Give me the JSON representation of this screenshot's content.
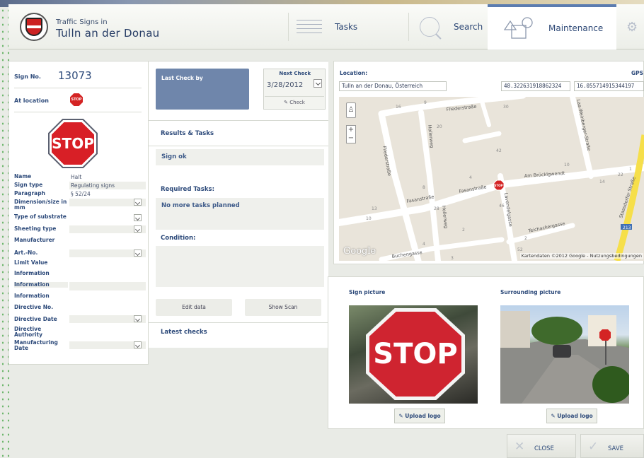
{
  "header": {
    "app_subtitle": "Traffic Signs in",
    "app_title": "Tulln an der Donau",
    "nav": [
      {
        "label": "Tasks",
        "icon": "list-icon"
      },
      {
        "label": "Search",
        "icon": "search-icon"
      },
      {
        "label": "Maintenance",
        "icon": "shapes-icon",
        "active": true
      },
      {
        "label": "",
        "icon": "gear-icon"
      }
    ]
  },
  "sign": {
    "number_label": "Sign No.",
    "number": "13073",
    "at_location_label": "At location",
    "mini_sign_text": "STOP",
    "sign_text": "STOP",
    "properties": [
      {
        "label": "Name",
        "value": "Halt",
        "dropdown": false
      },
      {
        "label": "Sign type",
        "value": "Regulating signs",
        "dropdown": false
      },
      {
        "label": "Paragraph",
        "value": "§ 52/24",
        "dropdown": false
      },
      {
        "label": "Dimension/size in mm",
        "value": "",
        "dropdown": true
      },
      {
        "label": "Type of substrate",
        "value": "",
        "dropdown": true
      },
      {
        "label": "Sheeting type",
        "value": "",
        "dropdown": true
      },
      {
        "label": "Manufacturer",
        "value": "",
        "dropdown": false
      },
      {
        "label": "Art.-No.",
        "value": "",
        "dropdown": true
      },
      {
        "label": "Limit Value",
        "value": "",
        "dropdown": false
      },
      {
        "label": "Information",
        "value": "",
        "dropdown": false
      },
      {
        "label": "Information",
        "value": "",
        "dropdown": false
      },
      {
        "label": "Information",
        "value": "",
        "dropdown": false
      },
      {
        "label": "Directive No.",
        "value": "",
        "dropdown": false
      },
      {
        "label": "Directive Date",
        "value": "",
        "dropdown": true
      },
      {
        "label": "Directive Authority",
        "value": "",
        "dropdown": false
      },
      {
        "label": "Manufacturing Date",
        "value": "",
        "dropdown": true
      }
    ]
  },
  "checks": {
    "last_check_label": "Last Check by",
    "next_check_label": "Next Check",
    "next_check_date": "3/28/2012",
    "check_button": "Check",
    "results_title": "Results & Tasks",
    "result_status": "Sign ok",
    "required_tasks_label": "Required Tasks:",
    "tasks_value": "No more tasks planned",
    "condition_label": "Condition:",
    "edit_button": "Edit data",
    "show_scan_button": "Show Scan",
    "latest_checks_label": "Latest checks"
  },
  "location": {
    "label": "Location:",
    "gps_label": "GPS",
    "address": "Tulln an der Donau, Österreich",
    "lat": "48.322631918862324",
    "lon": "16.055714915344197",
    "map": {
      "streets": [
        "Fliederstraße",
        "Fliederstraße",
        "Hollerweg",
        "Hollerweg",
        "Fasanstraße",
        "Fasanstraße",
        "Am Brücklgwendt",
        "Teichackergasse",
        "Buchengasse",
        "Staasdorfer Straße",
        "Lavendelgasse",
        "Laa-Weinberger-Straße"
      ],
      "numbers": [
        "16",
        "9",
        "20",
        "30",
        "42",
        "8",
        "4",
        "10",
        "13",
        "10",
        "28",
        "46",
        "2",
        "22",
        "52",
        "14",
        "1",
        "2",
        "4",
        "3"
      ],
      "route_badge": "213",
      "marker_text": "STOP",
      "google_logo": "Google",
      "attribution": "Kartendaten ©2012 Google - Nutzungsbedingungen",
      "pegman_glyph": "♙",
      "zoom_in": "+",
      "zoom_out": "−"
    }
  },
  "pictures": {
    "sign_picture_label": "Sign picture",
    "surrounding_picture_label": "Surrounding picture",
    "photo_sign_text": "STOP",
    "upload_button": "Upload logo"
  },
  "footer": {
    "close_label": "CLOSE",
    "save_label": "SAVE"
  },
  "colors": {
    "accent": "#6f86ab",
    "title_blue": "#2d4a7a",
    "stop_red": "#d81f26"
  }
}
